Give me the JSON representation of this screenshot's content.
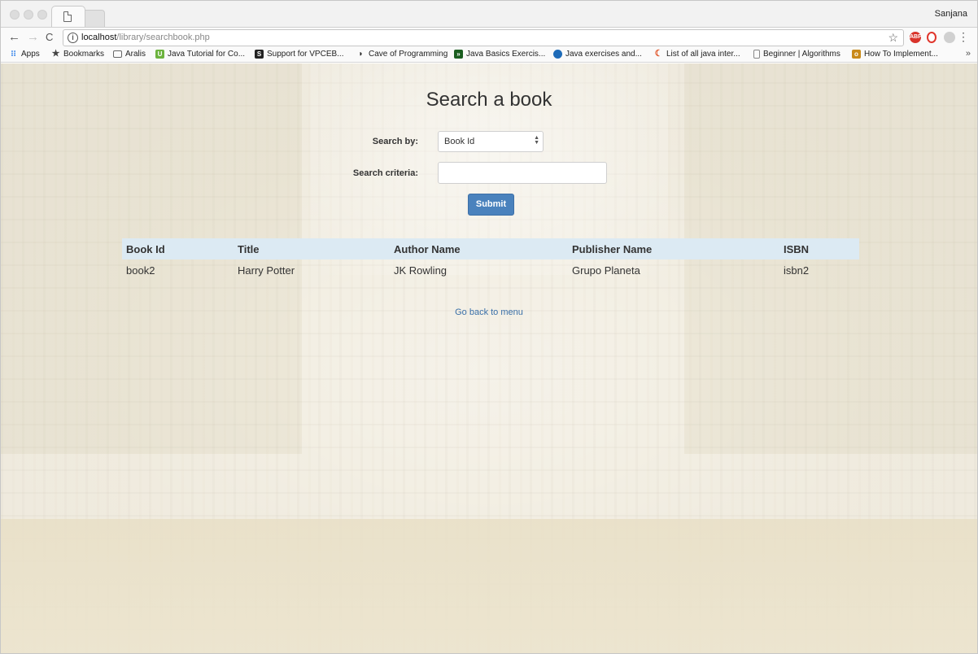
{
  "browser": {
    "profile_name": "Sanjana",
    "url_host": "localhost",
    "url_path": "/library/searchbook.php",
    "nav": {
      "back": "←",
      "forward": "→",
      "reload": "C"
    },
    "bookmarks": [
      {
        "label": "Apps",
        "icon": "apps-grid-icon",
        "icon_color": "#1a73e8"
      },
      {
        "label": "Bookmarks",
        "icon": "star-icon",
        "icon_color": "#444444"
      },
      {
        "label": "Aralis",
        "icon": "folder-icon",
        "icon_color": "#666666"
      },
      {
        "label": "Java Tutorial for Co...",
        "icon": "udemy-icon",
        "icon_color": "#6cb33e"
      },
      {
        "label": "Support for VPCEB...",
        "icon": "s-icon",
        "icon_color": "#222222"
      },
      {
        "label": "Cave of Programming",
        "icon": "cave-icon",
        "icon_color": "#222222"
      },
      {
        "label": "Java Basics Exercis...",
        "icon": "terminal-icon",
        "icon_color": "#1b5e20"
      },
      {
        "label": "Java exercises and...",
        "icon": "globe-icon",
        "icon_color": "#1e6bb8"
      },
      {
        "label": "List of all java inter...",
        "icon": "moon-icon",
        "icon_color": "#e0552a"
      },
      {
        "label": "Beginner | Algorithms",
        "icon": "page-icon",
        "icon_color": "#888888"
      },
      {
        "label": "How To Implement...",
        "icon": "box-icon",
        "icon_color": "#c98a1a"
      }
    ],
    "bookmarks_more": "»"
  },
  "page": {
    "title": "Search a book",
    "search_by_label": "Search by:",
    "search_by_value": "Book Id",
    "criteria_label": "Search criteria:",
    "criteria_value": "",
    "submit_label": "Submit",
    "back_link": "Go back to menu"
  },
  "results": {
    "columns": [
      "Book Id",
      "Title",
      "Author Name",
      "Publisher Name",
      "ISBN"
    ],
    "rows": [
      [
        "book2",
        "Harry Potter",
        "JK Rowling",
        "Grupo Planeta",
        "isbn2"
      ]
    ]
  },
  "colors": {
    "accent": "#4a82bd",
    "table_header": "#dceaf3",
    "link": "#3a6fa8"
  }
}
